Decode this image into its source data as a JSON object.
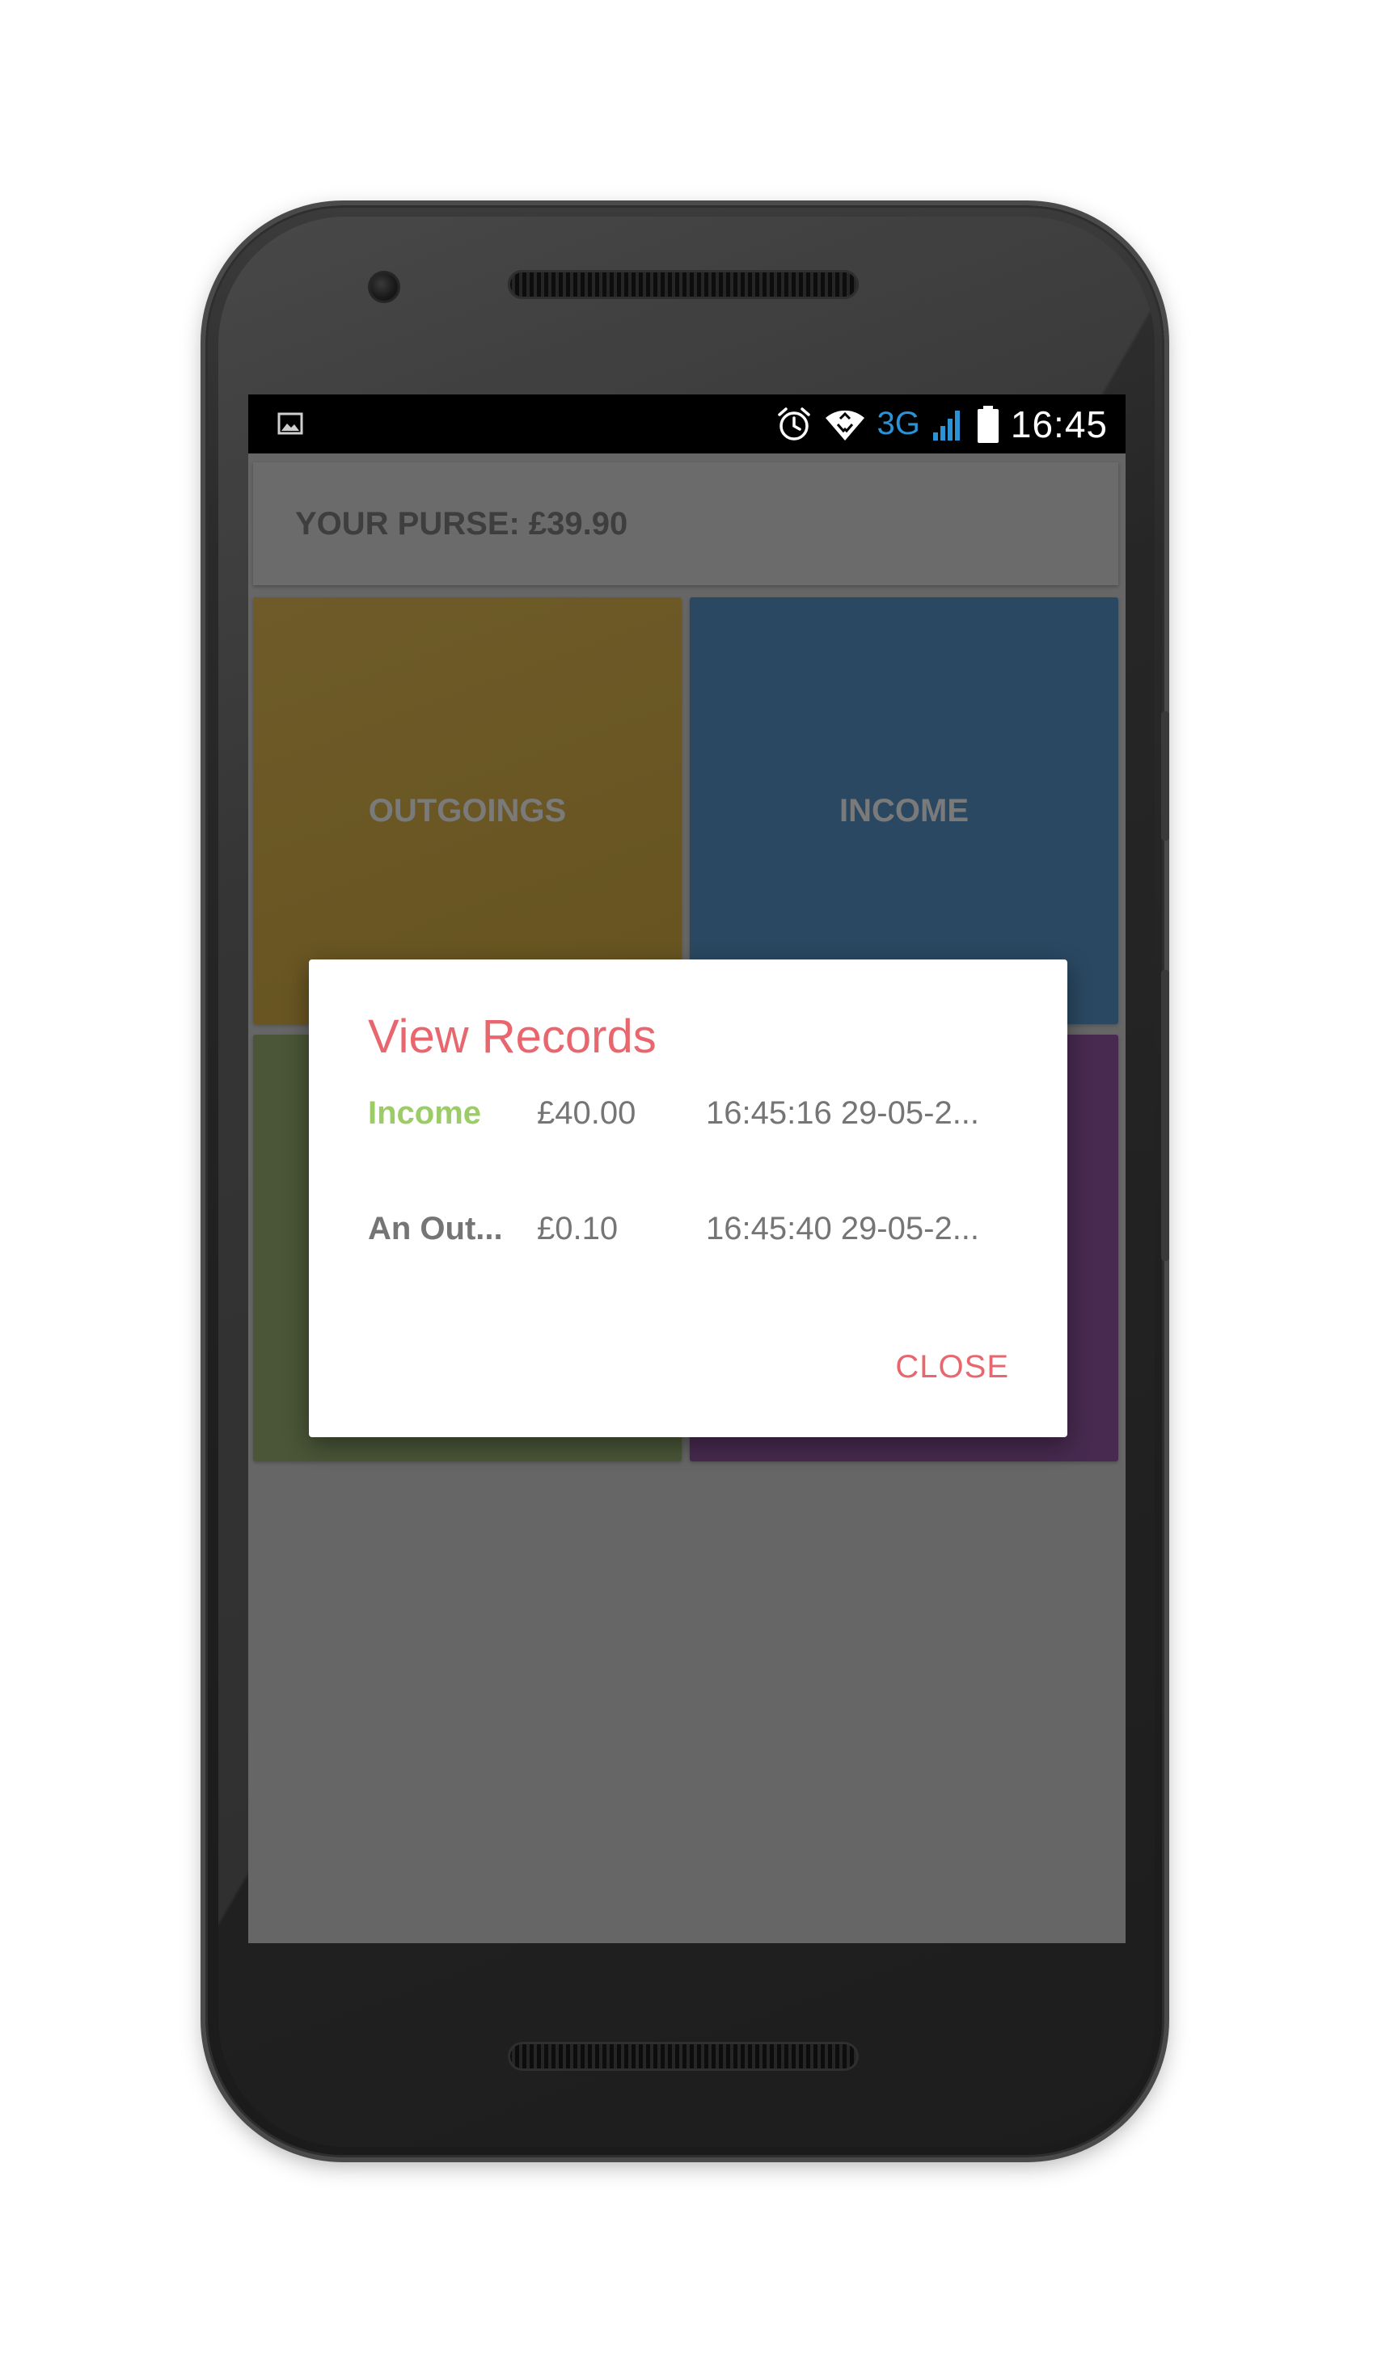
{
  "status_bar": {
    "time": "16:45",
    "network": "3G",
    "icons": [
      "image-icon",
      "alarm-icon",
      "wifi-icon",
      "signal-icon",
      "battery-icon"
    ]
  },
  "app_bar": {
    "purse_label": "YOUR PURSE: £39.90"
  },
  "tiles": {
    "outgoings": "OUTGOINGS",
    "income": "INCOME"
  },
  "dialog": {
    "title": "View Records",
    "records": [
      {
        "type": "Income",
        "amount": "£40.00",
        "time": "16:45:16 29-05-2..."
      },
      {
        "type": "An Out...",
        "amount": "£0.10",
        "time": "16:45:40 29-05-2..."
      }
    ],
    "close_label": "CLOSE"
  },
  "colors": {
    "accent": "#e8676e",
    "income_type": "#9ccc65",
    "outgoings_tile": "#66531f",
    "income_tile": "#2a4861",
    "green_tile": "#4a5637",
    "purple_tile": "#482a50"
  }
}
